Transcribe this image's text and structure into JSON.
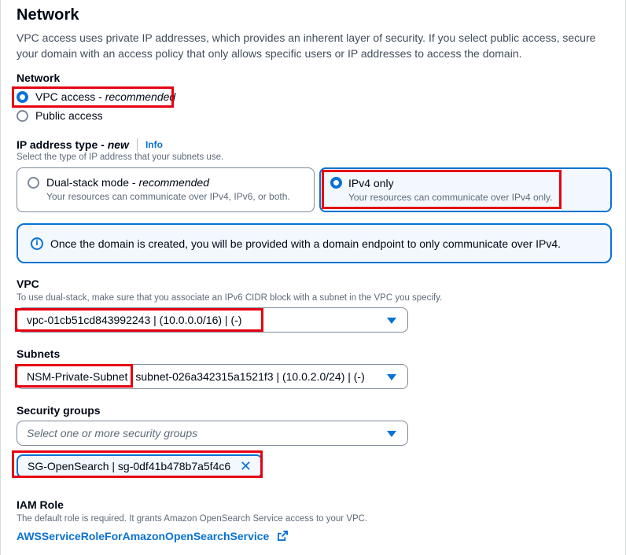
{
  "network": {
    "heading": "Network",
    "description": "VPC access uses private IP addresses, which provides an inherent layer of security. If you select public access, secure your domain with an access policy that only allows specific users or IP addresses to access the domain.",
    "group_label": "Network",
    "options": [
      {
        "label": "VPC access",
        "suffix": "recommended",
        "selected": true
      },
      {
        "label": "Public access",
        "selected": false
      }
    ]
  },
  "ip_type": {
    "label": "IP address type",
    "label_suffix": "new",
    "info_link": "Info",
    "description": "Select the type of IP address that your subnets use.",
    "tiles": [
      {
        "title": "Dual-stack mode",
        "title_suffix": "recommended",
        "description": "Your resources can communicate over IPv4, IPv6, or both.",
        "selected": false
      },
      {
        "title": "IPv4 only",
        "description": "Your resources can communicate over IPv4 only.",
        "selected": true
      }
    ]
  },
  "alert": {
    "icon": "info-icon",
    "text": "Once the domain is created, you will be provided with a domain endpoint to only communicate over IPv4."
  },
  "vpc": {
    "label": "VPC",
    "description": "To use dual-stack, make sure that you associate an IPv6 CIDR block with a subnet in the VPC you specify.",
    "value": "vpc-01cb51cd843992243 | (10.0.0.0/16) | (-)"
  },
  "subnets": {
    "label": "Subnets",
    "name": "NSM-Private-Subnet",
    "detail": "subnet-026a342315a1521f3 | (10.0.2.0/24) | (-)"
  },
  "security_groups": {
    "label": "Security groups",
    "placeholder": "Select one or more security groups",
    "token": "SG-OpenSearch | sg-0df41b478b7a5f4c6"
  },
  "iam": {
    "label": "IAM Role",
    "description": "The default role is required. It grants Amazon OpenSearch Service access to your VPC.",
    "link": "AWSServiceRoleForAmazonOpenSearchService"
  },
  "colors": {
    "accent": "#0972d3",
    "highlight": "#e60012",
    "text": "#000716",
    "muted": "#5f6b7a"
  }
}
